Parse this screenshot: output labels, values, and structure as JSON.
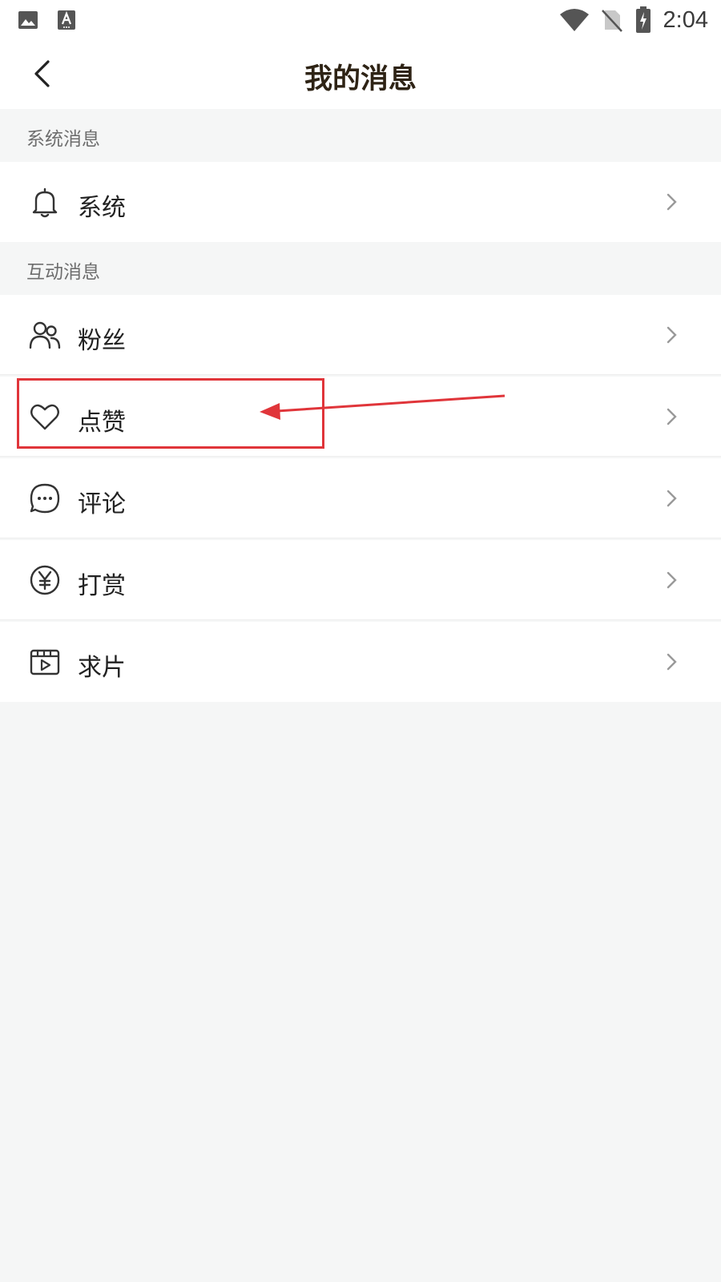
{
  "status_bar": {
    "time": "2:04",
    "left_icons": [
      "image-icon",
      "a-text-icon"
    ],
    "right_icons": [
      "wifi-icon",
      "no-sim-icon",
      "battery-charging-icon"
    ]
  },
  "header": {
    "title": "我的消息",
    "back_icon": "back-arrow-icon"
  },
  "sections": [
    {
      "title": "系统消息",
      "items": [
        {
          "label": "系统",
          "icon": "bell-icon"
        }
      ]
    },
    {
      "title": "互动消息",
      "items": [
        {
          "label": "粉丝",
          "icon": "fans-icon"
        },
        {
          "label": "点赞",
          "icon": "heart-icon"
        },
        {
          "label": "评论",
          "icon": "comment-icon"
        },
        {
          "label": "打赏",
          "icon": "yen-coin-icon"
        },
        {
          "label": "求片",
          "icon": "video-clapper-icon"
        }
      ]
    }
  ],
  "annotation": {
    "highlighted_item": "点赞",
    "color": "#e0353a"
  },
  "colors": {
    "background": "#f5f6f6",
    "surface": "#ffffff",
    "title": "#2e2315",
    "section_text": "#6e6e6e"
  }
}
